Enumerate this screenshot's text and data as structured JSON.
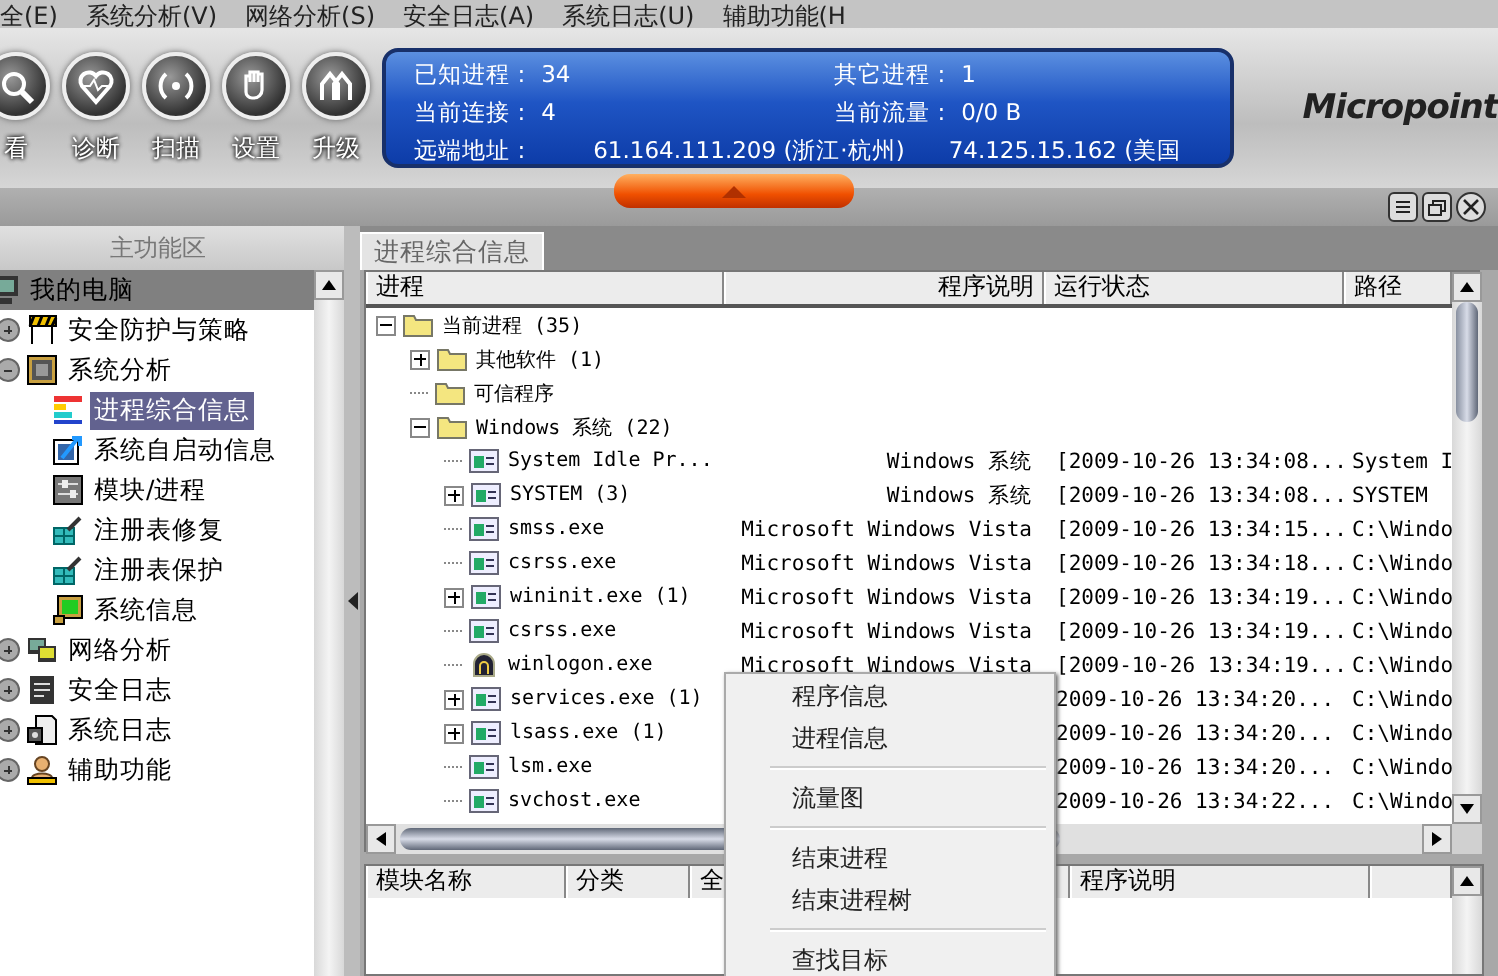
{
  "menu": [
    "全(E)",
    "系统分析(V)",
    "网络分析(S)",
    "安全日志(A)",
    "系统日志(U)",
    "辅助功能(H"
  ],
  "toolbar": [
    {
      "label": "看"
    },
    {
      "label": "诊断"
    },
    {
      "label": "扫描"
    },
    {
      "label": "设置"
    },
    {
      "label": "升级"
    }
  ],
  "info": {
    "stats": [
      {
        "label": "已知进程 :",
        "value": "34"
      },
      {
        "label": "其它进程 :",
        "value": "1"
      },
      {
        "label": "当前连接 :",
        "value": "4"
      },
      {
        "label": "当前流量 :",
        "value": "0/0 B"
      }
    ],
    "remote_label": "远端地址 :",
    "remote": [
      "61.164.111.209 (浙江·杭州)",
      "74.125.15.162 (美国"
    ]
  },
  "logo": "Micropoint",
  "sidebar": {
    "title": "主功能区",
    "tree": {
      "label": "我的电脑",
      "kind": "root",
      "selected": false,
      "children": [
        {
          "label": "安全防护与策略",
          "selected": false,
          "expanded": false
        },
        {
          "label": "系统分析",
          "selected": false,
          "expanded": true,
          "children": [
            {
              "label": "进程综合信息",
              "selected": true
            },
            {
              "label": "系统自启动信息",
              "selected": false
            },
            {
              "label": "模块/进程",
              "selected": false
            },
            {
              "label": "注册表修复",
              "selected": false
            },
            {
              "label": "注册表保护",
              "selected": false
            },
            {
              "label": "系统信息",
              "selected": false
            }
          ]
        },
        {
          "label": "网络分析",
          "selected": false,
          "expanded": false
        },
        {
          "label": "安全日志",
          "selected": false,
          "expanded": false
        },
        {
          "label": "系统日志",
          "selected": false,
          "expanded": false
        },
        {
          "label": "辅助功能",
          "selected": false,
          "expanded": false
        }
      ]
    }
  },
  "tabs": [
    {
      "label": "进程综合信息",
      "selected": true
    }
  ],
  "process_table": {
    "columns": [
      "进程",
      "程序说明",
      "运行状态",
      "路径"
    ],
    "tree": [
      {
        "label": "当前进程 (35)",
        "kind": "folder",
        "expanded": true,
        "children": [
          {
            "label": "其他软件 (1)",
            "kind": "folder",
            "expanded": false
          },
          {
            "label": "可信程序",
            "kind": "folder"
          },
          {
            "label": "Windows 系统 (22)",
            "kind": "folder",
            "expanded": true,
            "children": [
              {
                "label": "System Idle Pr...",
                "kind": "process",
                "desc": "Windows 系统",
                "status": "[2009-10-26 13:34:08...",
                "path": "System I"
              },
              {
                "label": "SYSTEM (3)",
                "kind": "process",
                "expanded": false,
                "desc": "Windows 系统",
                "status": "[2009-10-26 13:34:08...",
                "path": "SYSTEM"
              },
              {
                "label": "smss.exe",
                "kind": "process",
                "desc": "Microsoft Windows Vista",
                "status": "[2009-10-26 13:34:15...",
                "path": "C:\\Windo"
              },
              {
                "label": "csrss.exe",
                "kind": "process",
                "desc": "Microsoft Windows Vista",
                "status": "[2009-10-26 13:34:18...",
                "path": "C:\\Windo"
              },
              {
                "label": "wininit.exe (1)",
                "kind": "process",
                "expanded": false,
                "desc": "Microsoft Windows Vista",
                "status": "[2009-10-26 13:34:19...",
                "path": "C:\\Windo"
              },
              {
                "label": "csrss.exe",
                "kind": "process",
                "desc": "Microsoft Windows Vista",
                "status": "[2009-10-26 13:34:19...",
                "path": "C:\\Windo"
              },
              {
                "label": "winlogon.exe",
                "kind": "logon",
                "desc": "Microsoft Windows Vista",
                "status": "[2009-10-26 13:34:19...",
                "path": "C:\\Windo"
              },
              {
                "label": "services.exe (1)",
                "kind": "process",
                "expanded": false,
                "status": "2009-10-26 13:34:20...",
                "path": "C:\\Windo"
              },
              {
                "label": "lsass.exe (1)",
                "kind": "process",
                "expanded": false,
                "status": "2009-10-26 13:34:20...",
                "path": "C:\\Windo"
              },
              {
                "label": "lsm.exe",
                "kind": "process",
                "status": "2009-10-26 13:34:20...",
                "path": "C:\\Windo"
              },
              {
                "label": "svchost.exe",
                "kind": "process",
                "status": "2009-10-26 13:34:22...",
                "path": "C:\\Windo"
              }
            ]
          }
        ]
      }
    ]
  },
  "module_table": {
    "columns": [
      {
        "label": "模块名称"
      },
      {
        "label": "分类"
      },
      {
        "label": "全"
      },
      {
        "label": "程序说明"
      }
    ]
  },
  "context_menu": [
    {
      "kind": "item",
      "label": "程序信息"
    },
    {
      "kind": "item",
      "label": "进程信息"
    },
    {
      "kind": "separator"
    },
    {
      "kind": "item",
      "label": "流量图"
    },
    {
      "kind": "separator"
    },
    {
      "kind": "item",
      "label": "结束进程"
    },
    {
      "kind": "item",
      "label": "结束进程树"
    },
    {
      "kind": "separator"
    },
    {
      "kind": "item",
      "label": "查找目标"
    }
  ]
}
